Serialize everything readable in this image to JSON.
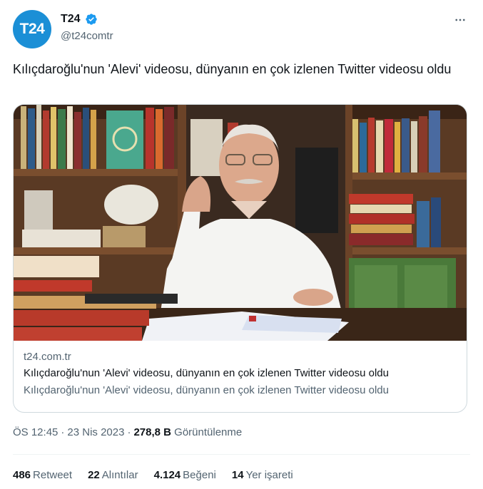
{
  "author": {
    "avatar_text": "T24",
    "display_name": "T24",
    "handle": "@t24comtr",
    "verified_icon": "verified-badge-icon",
    "brand_color": "#1b8fd6"
  },
  "tweet": {
    "text": "Kılıçdaroğlu'nun 'Alevi' videosu, dünyanın en çok izlenen Twitter videosu oldu"
  },
  "card": {
    "domain": "t24.com.tr",
    "title": "Kılıçdaroğlu'nun 'Alevi' videosu, dünyanın en çok izlenen Twitter videosu oldu",
    "description": "Kılıçdaroğlu'nun 'Alevi' videosu, dünyanın en çok izlenen Twitter videosu oldu"
  },
  "meta": {
    "time": "ÖS 12:45",
    "date": "23 Nis 2023",
    "views_count": "278,8 B",
    "views_label": "Görüntülenme"
  },
  "stats": {
    "retweets_count": "486",
    "retweets_label": "Retweet",
    "quotes_count": "22",
    "quotes_label": "Alıntılar",
    "likes_count": "4.124",
    "likes_label": "Beğeni",
    "bookmarks_count": "14",
    "bookmarks_label": "Yer işareti"
  }
}
